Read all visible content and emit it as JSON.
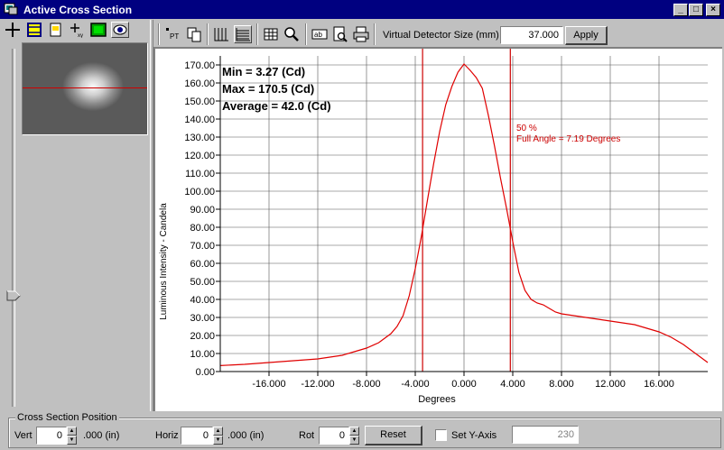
{
  "window": {
    "title": "Active Cross Section",
    "controls": {
      "minimize": "_",
      "maximize": "□",
      "close": "×"
    }
  },
  "left_toolbar": {
    "icons": [
      "crosshair-icon",
      "filmstrip-icon",
      "image-file-icon",
      "coordinate-tool-icon",
      "color-map-icon",
      "eye-icon"
    ]
  },
  "toolbar": {
    "icons": [
      "label-points-icon",
      "copy-icon",
      "vertical-grid-icon",
      "horizontal-grid-icon",
      "table-grid-icon",
      "zoom-icon",
      "text-label-icon",
      "print-preview-icon",
      "print-icon"
    ],
    "detector_label": "Virtual Detector Size (mm)",
    "detector_value": "37.000",
    "apply_label": "Apply"
  },
  "stats": {
    "min": "Min = 3.27 (Cd)",
    "max": "Max = 170.5 (Cd)",
    "average": "Average = 42.0 (Cd)"
  },
  "annotation": {
    "line1": "50 %",
    "line2": "Full Angle = 7.19 Degrees"
  },
  "chart_data": {
    "type": "line",
    "xlabel": "Degrees",
    "ylabel": "Luminous Intensity - Candela",
    "xlim": [
      -20,
      20
    ],
    "ylim": [
      0,
      175
    ],
    "x_ticks": [
      "-16.000",
      "-12.000",
      "-8.000",
      "-4.000",
      "0.000",
      "4.000",
      "8.000",
      "12.000",
      "16.000"
    ],
    "x_tick_values": [
      -16,
      -12,
      -8,
      -4,
      0,
      4,
      8,
      12,
      16
    ],
    "y_ticks": [
      "0.00",
      "10.00",
      "20.00",
      "30.00",
      "40.00",
      "50.00",
      "60.00",
      "70.00",
      "80.00",
      "90.00",
      "100.00",
      "110.00",
      "120.00",
      "130.00",
      "140.00",
      "150.00",
      "160.00",
      "170.00"
    ],
    "y_tick_values": [
      0,
      10,
      20,
      30,
      40,
      50,
      60,
      70,
      80,
      90,
      100,
      110,
      120,
      130,
      140,
      150,
      160,
      170
    ],
    "grid": true,
    "series_color": "#e00000",
    "marker_lines_x": [
      -3.4,
      3.8
    ],
    "x": [
      -20,
      -18,
      -16,
      -14,
      -12,
      -10,
      -9,
      -8,
      -7,
      -6,
      -5.5,
      -5,
      -4.5,
      -4,
      -3.5,
      -3,
      -2.5,
      -2,
      -1.5,
      -1,
      -0.5,
      0,
      0.5,
      1,
      1.5,
      2,
      2.5,
      3,
      3.5,
      4,
      4.5,
      5,
      5.5,
      6,
      6.5,
      7,
      7.5,
      8,
      9,
      10,
      11,
      12,
      13,
      14,
      15,
      16,
      17,
      18,
      19,
      20
    ],
    "y": [
      3.3,
      4,
      5,
      6,
      7,
      9,
      11,
      13,
      16,
      21,
      25,
      31,
      42,
      57,
      75,
      95,
      115,
      133,
      148,
      158,
      166,
      170.5,
      167,
      163,
      157,
      142,
      125,
      107,
      90,
      72,
      55,
      45,
      40,
      38,
      37,
      35,
      33,
      32,
      31,
      30,
      29,
      28,
      27,
      26,
      24,
      22,
      19,
      15,
      10,
      5
    ]
  },
  "cross_section": {
    "group_label": "Cross Section Position",
    "vert_label": "Vert",
    "vert_value": "0",
    "vert_suffix": ".000 (in)",
    "horiz_label": "Horiz",
    "horiz_value": "0",
    "horiz_suffix": ".000 (in)",
    "rot_label": "Rot",
    "rot_value": "0",
    "reset_label": "Reset",
    "set_y_label": "Set Y-Axis",
    "y_axis_value": "230"
  }
}
